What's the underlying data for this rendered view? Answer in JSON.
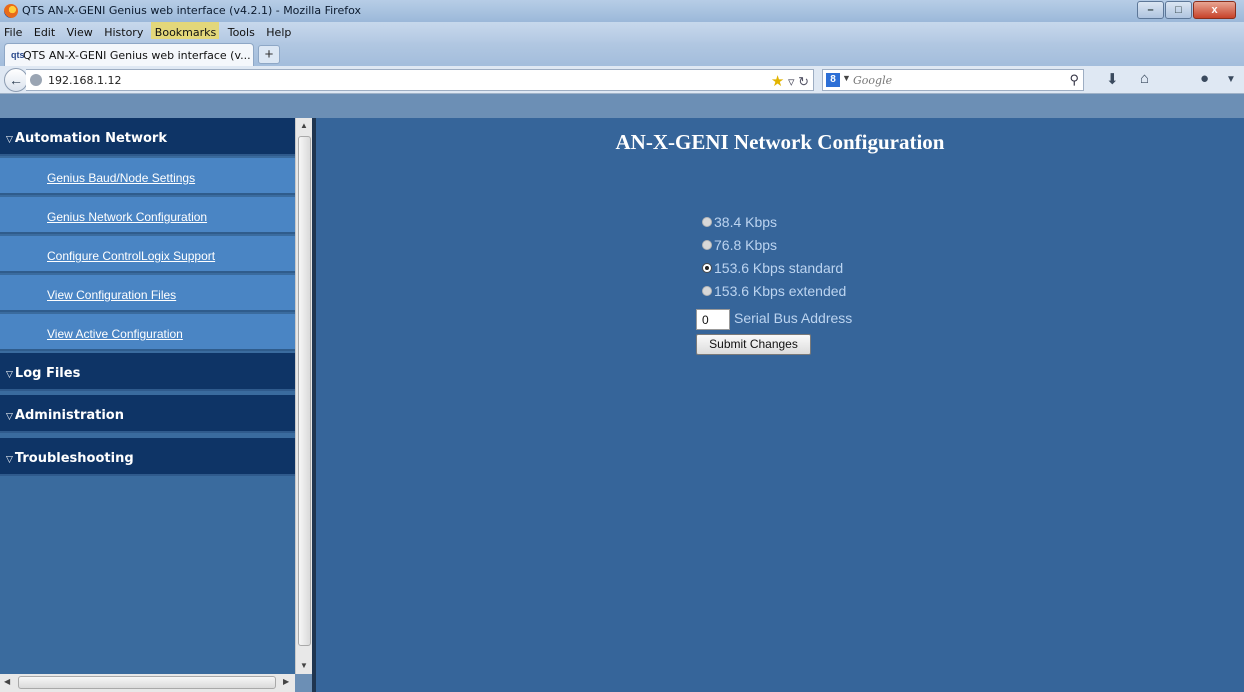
{
  "window": {
    "title": "QTS AN-X-GENI Genius web interface (v4.2.1) - Mozilla Firefox",
    "controls": [
      "–",
      "□",
      "x"
    ]
  },
  "menubar": {
    "items": [
      "File",
      "Edit",
      "View",
      "History",
      "Bookmarks",
      "Tools",
      "Help"
    ]
  },
  "tab": {
    "title": "QTS AN-X-GENI Genius web interface (v...",
    "new_tab": "+"
  },
  "navbar": {
    "url": "192.168.1.12",
    "search_placeholder": "Google",
    "search_engine_letter": "8",
    "icons": [
      "back-icon",
      "globe-icon",
      "star-icon",
      "reload-icon",
      "search-icon",
      "download-icon",
      "home-icon",
      "addon-icon"
    ]
  },
  "sidebar": {
    "sections": [
      {
        "label": "Automation Network",
        "links": [
          "Genius Baud/Node Settings",
          "Genius Network Configuration",
          "Configure ControlLogix Support",
          "View Configuration Files",
          "View Active Configuration"
        ]
      },
      {
        "label": "Log Files"
      },
      {
        "label": "Administration"
      },
      {
        "label": "Troubleshooting"
      }
    ]
  },
  "main": {
    "title": "AN-X-GENI Network Configuration",
    "options": [
      {
        "label": "38.4 Kbps",
        "checked": false
      },
      {
        "label": "76.8 Kbps",
        "checked": false
      },
      {
        "label": "153.6 Kbps standard",
        "checked": true
      },
      {
        "label": "153.6 Kbps extended",
        "checked": false
      }
    ],
    "address_value": "0",
    "address_label": "Serial Bus Address",
    "submit_label": "Submit Changes"
  }
}
